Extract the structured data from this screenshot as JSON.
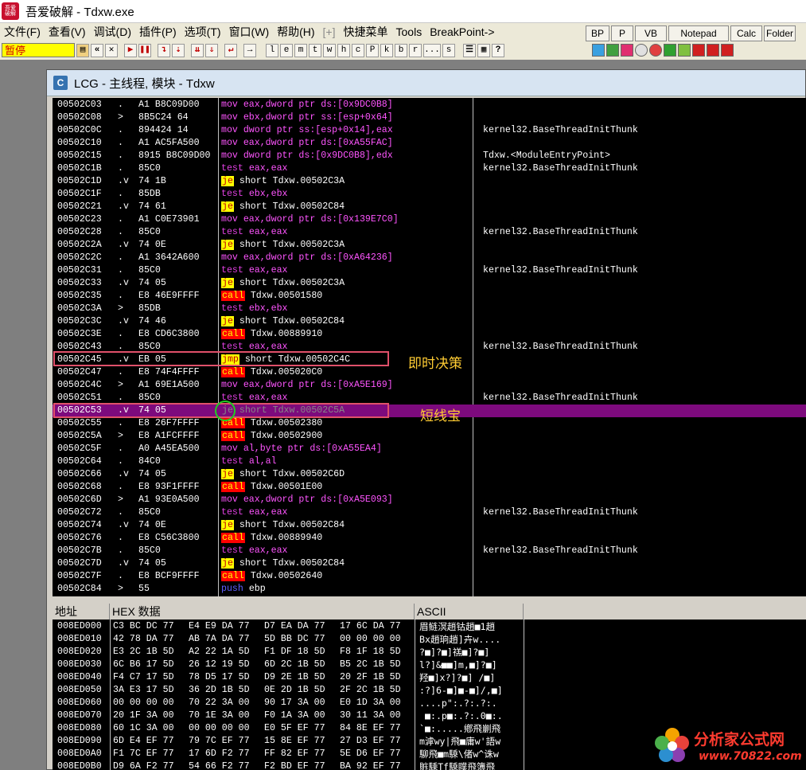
{
  "window": {
    "title": "吾爱破解 - Tdxw.exe",
    "icon_text": "吾爱破解"
  },
  "menu": [
    "文件(F)",
    "查看(V)",
    "调试(D)",
    "插件(P)",
    "选项(T)",
    "窗口(W)",
    "帮助(H)",
    "[+]",
    "快捷菜单",
    "Tools",
    "BreakPoint->"
  ],
  "quick_buttons": [
    "BP",
    "P",
    "VB",
    "Notepad",
    "Calc",
    "Folder"
  ],
  "toolbar": {
    "status": "暂停",
    "letters": [
      "l",
      "e",
      "m",
      "t",
      "w",
      "h",
      "c",
      "P",
      "k",
      "b",
      "r",
      "...",
      "s"
    ]
  },
  "cpu_window": {
    "icon": "C",
    "title": "LCG - 主线程, 模块 - Tdxw"
  },
  "colors": {
    "selected_row": "#7d0a7d",
    "annotation_box": "#e0506a",
    "annotation_text": "#ffcc33",
    "green_ring": "#22cc22"
  },
  "annotations": [
    {
      "label": "即时决策"
    },
    {
      "label": "短线宝"
    }
  ],
  "disasm": [
    {
      "addr": "00502C03",
      "mark": ".",
      "hex": "A1 B8C09D00",
      "mn": "mov",
      "ops": "eax,dword ptr ds:[0x9DC0B8]",
      "cmt": ""
    },
    {
      "addr": "00502C08",
      "mark": ">",
      "hex": "8B5C24 64",
      "mn": "mov",
      "ops": "ebx,dword ptr ss:[esp+0x64]",
      "cmt": ""
    },
    {
      "addr": "00502C0C",
      "mark": ".",
      "hex": "894424 14",
      "mn": "mov",
      "ops": "dword ptr ss:[esp+0x14],eax",
      "cmt": "kernel32.BaseThreadInitThunk"
    },
    {
      "addr": "00502C10",
      "mark": ".",
      "hex": "A1 AC5FA500",
      "mn": "mov",
      "ops": "eax,dword ptr ds:[0xA55FAC]",
      "cmt": ""
    },
    {
      "addr": "00502C15",
      "mark": ".",
      "hex": "8915 B8C09D00",
      "mn": "mov",
      "ops": "dword ptr ds:[0x9DC0B8],edx",
      "cmt": "Tdxw.<ModuleEntryPoint>"
    },
    {
      "addr": "00502C1B",
      "mark": ".",
      "hex": "85C0",
      "mn": "test",
      "ops": "eax,eax",
      "cmt": "kernel32.BaseThreadInitThunk"
    },
    {
      "addr": "00502C1D",
      "mark": ".v",
      "hex": "74 1B",
      "mn": "je",
      "ops": "short Tdxw.00502C3A",
      "cmt": ""
    },
    {
      "addr": "00502C1F",
      "mark": ".",
      "hex": "85DB",
      "mn": "test",
      "ops": "ebx,ebx",
      "cmt": ""
    },
    {
      "addr": "00502C21",
      "mark": ".v",
      "hex": "74 61",
      "mn": "je",
      "ops": "short Tdxw.00502C84",
      "cmt": ""
    },
    {
      "addr": "00502C23",
      "mark": ".",
      "hex": "A1 C0E73901",
      "mn": "mov",
      "ops": "eax,dword ptr ds:[0x139E7C0]",
      "cmt": ""
    },
    {
      "addr": "00502C28",
      "mark": ".",
      "hex": "85C0",
      "mn": "test",
      "ops": "eax,eax",
      "cmt": "kernel32.BaseThreadInitThunk"
    },
    {
      "addr": "00502C2A",
      "mark": ".v",
      "hex": "74 0E",
      "mn": "je",
      "ops": "short Tdxw.00502C3A",
      "cmt": ""
    },
    {
      "addr": "00502C2C",
      "mark": ".",
      "hex": "A1 3642A600",
      "mn": "mov",
      "ops": "eax,dword ptr ds:[0xA64236]",
      "cmt": ""
    },
    {
      "addr": "00502C31",
      "mark": ".",
      "hex": "85C0",
      "mn": "test",
      "ops": "eax,eax",
      "cmt": "kernel32.BaseThreadInitThunk"
    },
    {
      "addr": "00502C33",
      "mark": ".v",
      "hex": "74 05",
      "mn": "je",
      "ops": "short Tdxw.00502C3A",
      "cmt": ""
    },
    {
      "addr": "00502C35",
      "mark": ".",
      "hex": "E8 46E9FFFF",
      "mn": "call",
      "ops": "Tdxw.00501580",
      "cmt": ""
    },
    {
      "addr": "00502C3A",
      "mark": ">",
      "hex": "85DB",
      "mn": "test",
      "ops": "ebx,ebx",
      "cmt": ""
    },
    {
      "addr": "00502C3C",
      "mark": ".v",
      "hex": "74 46",
      "mn": "je",
      "ops": "short Tdxw.00502C84",
      "cmt": ""
    },
    {
      "addr": "00502C3E",
      "mark": ".",
      "hex": "E8 CD6C3800",
      "mn": "call",
      "ops": "Tdxw.00889910",
      "cmt": ""
    },
    {
      "addr": "00502C43",
      "mark": ".",
      "hex": "85C0",
      "mn": "test",
      "ops": "eax,eax",
      "cmt": "kernel32.BaseThreadInitThunk"
    },
    {
      "addr": "00502C45",
      "mark": ".v",
      "hex": "EB 05",
      "mn": "jmp",
      "ops": "short Tdxw.00502C4C",
      "cmt": ""
    },
    {
      "addr": "00502C47",
      "mark": ".",
      "hex": "E8 74F4FFFF",
      "mn": "call",
      "ops": "Tdxw.005020C0",
      "cmt": ""
    },
    {
      "addr": "00502C4C",
      "mark": ">",
      "hex": "A1 69E1A500",
      "mn": "mov",
      "ops": "eax,dword ptr ds:[0xA5E169]",
      "cmt": ""
    },
    {
      "addr": "00502C51",
      "mark": ".",
      "hex": "85C0",
      "mn": "test",
      "ops": "eax,eax",
      "cmt": "kernel32.BaseThreadInitThunk"
    },
    {
      "addr": "00502C53",
      "mark": ".v",
      "hex": "74 05",
      "mn": "je",
      "ops": "short Tdxw.00502C5A",
      "cmt": ""
    },
    {
      "addr": "00502C55",
      "mark": ".",
      "hex": "E8 26F7FFFF",
      "mn": "call",
      "ops": "Tdxw.00502380",
      "cmt": ""
    },
    {
      "addr": "00502C5A",
      "mark": ">",
      "hex": "E8 A1FCFFFF",
      "mn": "call",
      "ops": "Tdxw.00502900",
      "cmt": ""
    },
    {
      "addr": "00502C5F",
      "mark": ".",
      "hex": "A0 A45EA500",
      "mn": "mov",
      "ops": "al,byte ptr ds:[0xA55EA4]",
      "cmt": ""
    },
    {
      "addr": "00502C64",
      "mark": ".",
      "hex": "84C0",
      "mn": "test",
      "ops": "al,al",
      "cmt": ""
    },
    {
      "addr": "00502C66",
      "mark": ".v",
      "hex": "74 05",
      "mn": "je",
      "ops": "short Tdxw.00502C6D",
      "cmt": ""
    },
    {
      "addr": "00502C68",
      "mark": ".",
      "hex": "E8 93F1FFFF",
      "mn": "call",
      "ops": "Tdxw.00501E00",
      "cmt": ""
    },
    {
      "addr": "00502C6D",
      "mark": ">",
      "hex": "A1 93E0A500",
      "mn": "mov",
      "ops": "eax,dword ptr ds:[0xA5E093]",
      "cmt": ""
    },
    {
      "addr": "00502C72",
      "mark": ".",
      "hex": "85C0",
      "mn": "test",
      "ops": "eax,eax",
      "cmt": "kernel32.BaseThreadInitThunk"
    },
    {
      "addr": "00502C74",
      "mark": ".v",
      "hex": "74 0E",
      "mn": "je",
      "ops": "short Tdxw.00502C84",
      "cmt": ""
    },
    {
      "addr": "00502C76",
      "mark": ".",
      "hex": "E8 C56C3800",
      "mn": "call",
      "ops": "Tdxw.00889940",
      "cmt": ""
    },
    {
      "addr": "00502C7B",
      "mark": ".",
      "hex": "85C0",
      "mn": "test",
      "ops": "eax,eax",
      "cmt": "kernel32.BaseThreadInitThunk"
    },
    {
      "addr": "00502C7D",
      "mark": ".v",
      "hex": "74 05",
      "mn": "je",
      "ops": "short Tdxw.00502C84",
      "cmt": ""
    },
    {
      "addr": "00502C7F",
      "mark": ".",
      "hex": "E8 BCF9FFFF",
      "mn": "call",
      "ops": "Tdxw.00502640",
      "cmt": ""
    },
    {
      "addr": "00502C84",
      "mark": ">",
      "hex": "55",
      "mn": "push",
      "ops": "ebp",
      "cmt": ""
    }
  ],
  "dump": {
    "headers": [
      "地址",
      "HEX 数据",
      "ASCII"
    ],
    "rows": [
      {
        "addr": "008ED000",
        "g": [
          "C3 BC DC 77",
          "E4 E9 DA 77",
          "D7 EA DA 77",
          "17 6C DA 77"
        ],
        "ascii": "眉鲢溟趙钴趙■1趙"
      },
      {
        "addr": "008ED010",
        "g": [
          "42 78 DA 77",
          "AB 7A DA 77",
          "5D BB DC 77",
          "00 00 00 00"
        ],
        "ascii": "Bx趙珦趙]卉w...."
      },
      {
        "addr": "008ED020",
        "g": [
          "E3 2C 1B 5D",
          "A2 22 1A 5D",
          "F1 DF 18 5D",
          "F8 1F 18 5D"
        ],
        "ascii": "?■]?■]禚■]?■]"
      },
      {
        "addr": "008ED030",
        "g": [
          "6C B6 17 5D",
          "26 12 19 5D",
          "6D 2C 1B 5D",
          "B5 2C 1B 5D"
        ],
        "ascii": "l?]&■■]m,■]?■]"
      },
      {
        "addr": "008ED040",
        "g": [
          "F4 C7 17 5D",
          "78 D5 17 5D",
          "D9 2E 1B 5D",
          "20 2F 1B 5D"
        ],
        "ascii": "羟■]x?]?■] /■]"
      },
      {
        "addr": "008ED050",
        "g": [
          "3A E3 17 5D",
          "36 2D 1B 5D",
          "0E 2D 1B 5D",
          "2F 2C 1B 5D"
        ],
        "ascii": ":?]6-■]■-■]/,■]"
      },
      {
        "addr": "008ED060",
        "g": [
          "00 00 00 00",
          "70 22 3A 00",
          "90 17 3A 00",
          "E0 1D 3A 00"
        ],
        "ascii": "....p\":.?:.?:."
      },
      {
        "addr": "008ED070",
        "g": [
          "20 1F 3A 00",
          "70 1E 3A 00",
          "F0 1A 3A 00",
          "30 11 3A 00"
        ],
        "ascii": " ■:.p■:.?:.0■:."
      },
      {
        "addr": "008ED080",
        "g": [
          "60 1C 3A 00",
          "00 00 00 00",
          "E0 5F EF 77",
          "84 8E EF 77"
        ],
        "ascii": "`■:.....鄕飛剻飛"
      },
      {
        "addr": "008ED090",
        "g": [
          "6D E4 EF 77",
          "79 7C EF 77",
          "15 8E EF 77",
          "27 D3 EF 77"
        ],
        "ascii": "m滹wy|飛■庸w'語w"
      },
      {
        "addr": "008ED0A0",
        "g": [
          "F1 7C EF 77",
          "17 6D F2 77",
          "FF 82 EF 77",
          "5E D6 EF 77"
        ],
        "ascii": "駠飛■m騬\\偖w^诛w"
      },
      {
        "addr": "008ED0B0",
        "g": [
          "D9 6A F2 77",
          "54 66 F2 77",
          "F2 BD EF 77",
          "BA 92 EF 77"
        ],
        "ascii": "賘騬Tf騬瞨飛簿飛"
      }
    ]
  },
  "watermark": {
    "text": "分析家公式网",
    "url": "www.70822.com"
  }
}
